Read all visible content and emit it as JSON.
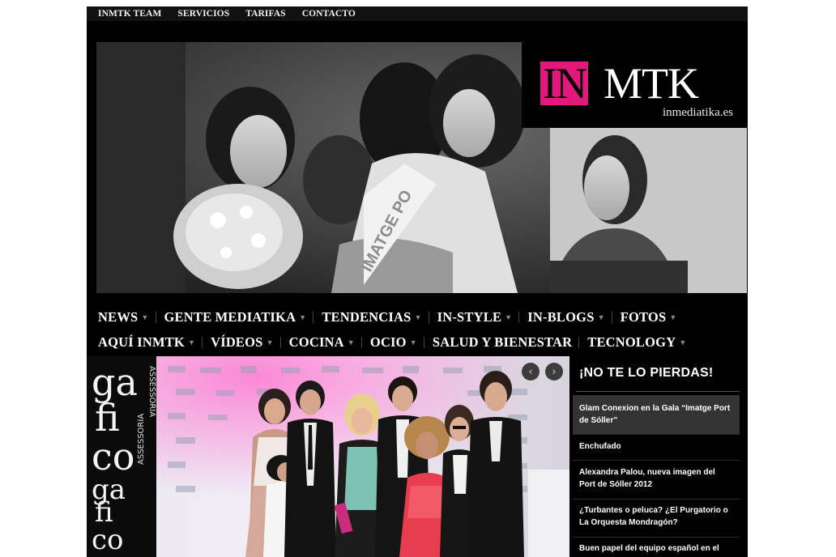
{
  "topnav": {
    "items": [
      "INMTK TEAM",
      "SERVICIOS",
      "TARIFAS",
      "CONTACTO"
    ]
  },
  "logo": {
    "in": "IN",
    "mtk": "MTK",
    "domain": "inmediatika.es"
  },
  "hero": {
    "sash_text": "IMATGE PO"
  },
  "categories": {
    "row1": [
      "NEWS",
      "GENTE MEDIATIKA",
      "TENDENCIAS",
      "IN-STYLE",
      "IN-BLOGS",
      "FOTOS"
    ],
    "row2": [
      "AQUÍ INMTK",
      "VÍDEOS",
      "COCINA",
      "OCIO",
      "SALUD Y BIENESTAR",
      "TECNOLOGY"
    ]
  },
  "slider": {
    "prev_icon": "chevron-left-icon",
    "next_icon": "chevron-right-icon",
    "backdrop_text": [
      "ga",
      "fi",
      "co",
      "ASSESSORIA",
      "ga",
      "fi",
      "co",
      "ASSESSORIA"
    ]
  },
  "sidebar": {
    "title": "¡NO TE LO PIERDAS!",
    "items": [
      "Glam Conexion en la Gala “Imatge Port de Sóller”",
      "Enchufado",
      "Alexandra Palou, nueva imagen del Port de Sóller 2012",
      "¿Turbantes o peluca? ¿El Purgatorio o La Orquesta Mondragón?",
      "Buen papel del equipo español en el"
    ]
  },
  "colors": {
    "brand_pink": "#e2187d",
    "background": "#000000",
    "page": "#ffffff"
  }
}
